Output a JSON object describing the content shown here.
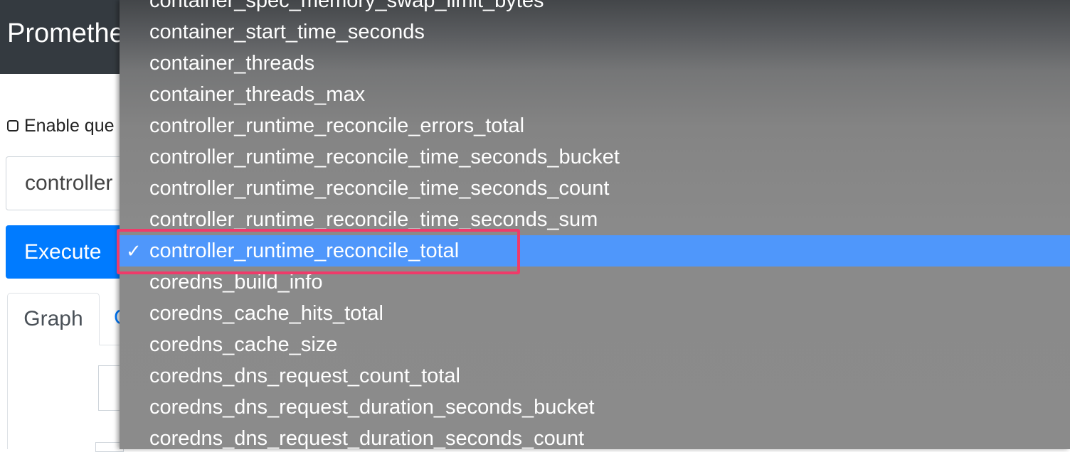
{
  "app": {
    "brand": "Promethe"
  },
  "options_checkbox": {
    "label": "Enable que"
  },
  "query": {
    "value": "controller"
  },
  "execute_button": {
    "label": "Execute"
  },
  "tabs": [
    {
      "label": "Graph"
    },
    {
      "label": "C"
    }
  ],
  "metric_dropdown": {
    "selected_index": 8,
    "check_glyph": "✓",
    "options": [
      "container_spec_memory_swap_limit_bytes",
      "container_start_time_seconds",
      "container_threads",
      "container_threads_max",
      "controller_runtime_reconcile_errors_total",
      "controller_runtime_reconcile_time_seconds_bucket",
      "controller_runtime_reconcile_time_seconds_count",
      "controller_runtime_reconcile_time_seconds_sum",
      "controller_runtime_reconcile_total",
      "coredns_build_info",
      "coredns_cache_hits_total",
      "coredns_cache_size",
      "coredns_dns_request_count_total",
      "coredns_dns_request_duration_seconds_bucket",
      "coredns_dns_request_duration_seconds_count"
    ]
  },
  "colors": {
    "navbar": "#343a40",
    "primary": "#007bff",
    "selected_option": "#4f97fb",
    "highlight_outline": "#ef3b6a"
  }
}
